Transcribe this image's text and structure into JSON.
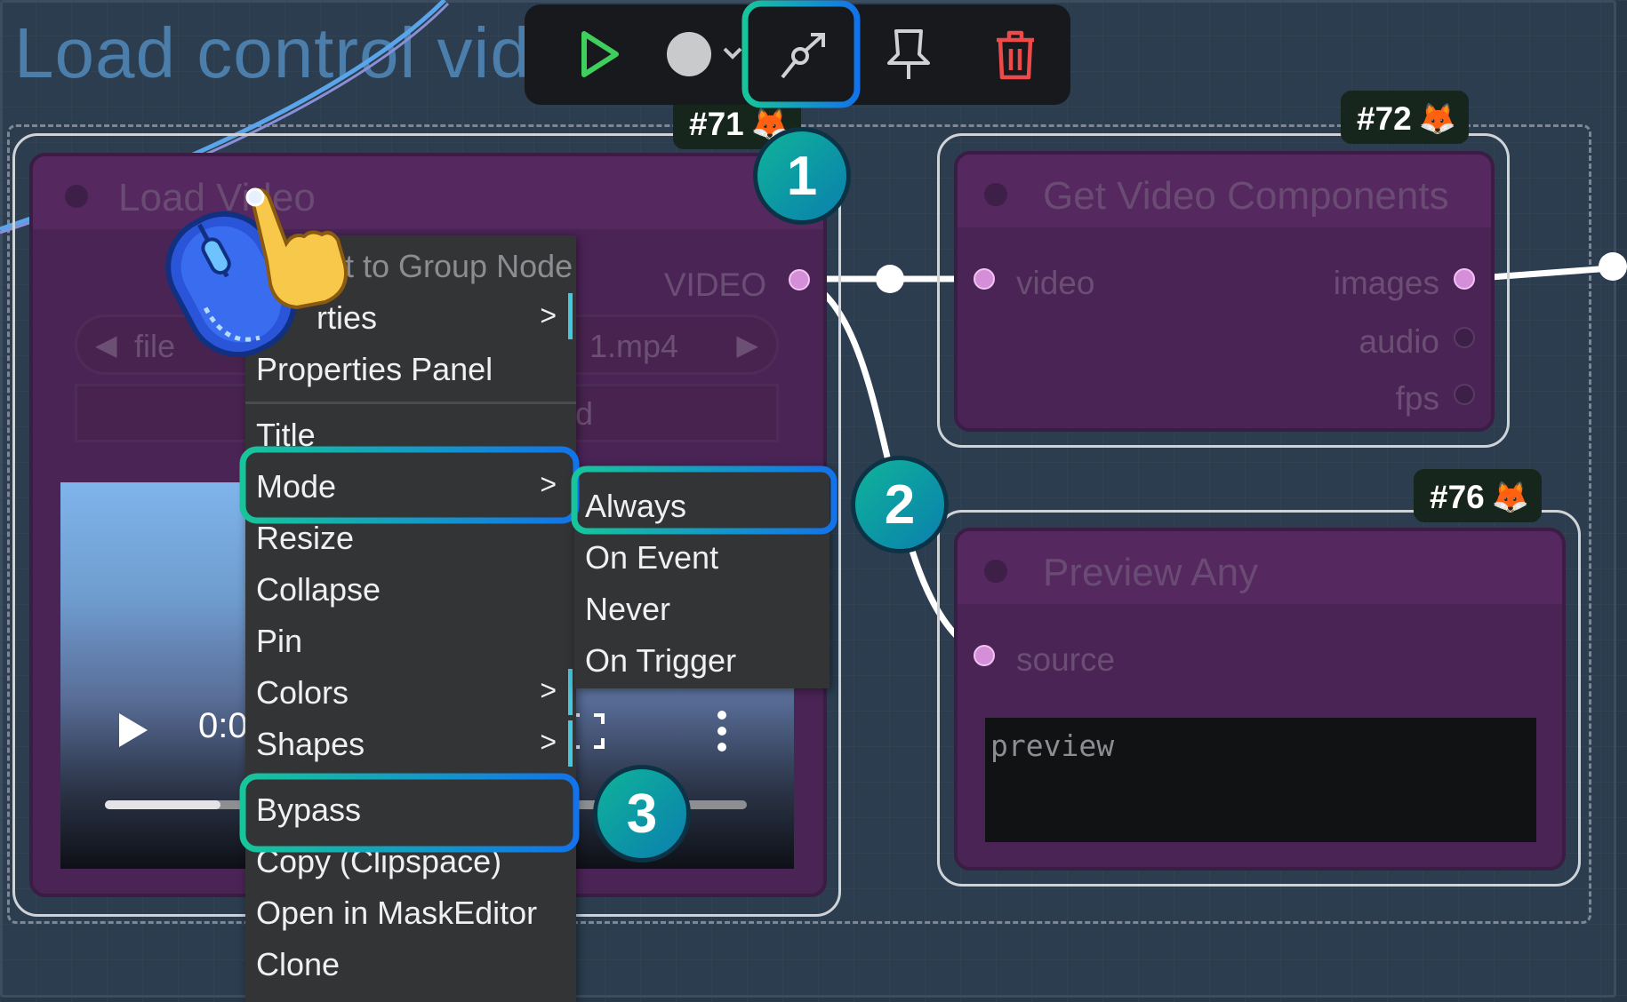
{
  "group": {
    "title": "Load control video"
  },
  "toolbar": {
    "run_icon": "play-icon",
    "color_icon": "color-circle-icon",
    "bypass_icon": "bypass-arrow-icon",
    "pin_icon": "pin-icon",
    "delete_icon": "trash-icon"
  },
  "nodes": {
    "load_video": {
      "badge": "#71",
      "title": "Load Video",
      "output_label": "VIDEO",
      "file_widget_label": "file",
      "file_widget_value": "1.mp4",
      "upload_widget_value": "d",
      "video": {
        "time": "0:0"
      }
    },
    "get_video_components": {
      "badge": "#72",
      "title": "Get Video Components",
      "inputs": [
        "video"
      ],
      "outputs": [
        "images",
        "audio",
        "fps"
      ]
    },
    "preview_any": {
      "badge": "#76",
      "title": "Preview Any",
      "input": "source",
      "preview_placeholder": "preview"
    }
  },
  "context_menu": {
    "items": [
      {
        "label": "Convert to Group Node",
        "display": "rt to Group Node",
        "disabled": true,
        "has_submenu": false
      },
      {
        "label": "Properties",
        "display": "rties",
        "disabled": false,
        "has_submenu": true
      },
      {
        "label": "Properties Panel",
        "disabled": false,
        "has_submenu": false
      },
      {
        "label": "Title",
        "disabled": false,
        "has_submenu": false
      },
      {
        "label": "Mode",
        "disabled": false,
        "has_submenu": true
      },
      {
        "label": "Resize",
        "disabled": false,
        "has_submenu": false
      },
      {
        "label": "Collapse",
        "disabled": false,
        "has_submenu": false
      },
      {
        "label": "Pin",
        "disabled": false,
        "has_submenu": false
      },
      {
        "label": "Colors",
        "disabled": false,
        "has_submenu": true
      },
      {
        "label": "Shapes",
        "disabled": false,
        "has_submenu": true
      },
      {
        "label": "Bypass",
        "disabled": false,
        "has_submenu": false
      },
      {
        "label": "Copy (Clipspace)",
        "disabled": false,
        "has_submenu": false
      },
      {
        "label": "Open in MaskEditor",
        "disabled": false,
        "has_submenu": false
      },
      {
        "label": "Clone",
        "disabled": false,
        "has_submenu": false
      }
    ],
    "arrow": ">"
  },
  "mode_submenu": {
    "items": [
      "Always",
      "On Event",
      "Never",
      "On Trigger"
    ]
  },
  "steps": [
    "1",
    "2",
    "3"
  ],
  "colors": {
    "accent_green": "#16c29a",
    "accent_blue": "#1276e8",
    "node_body": "#4b2456",
    "menu_bg": "#333436",
    "canvas_bg": "#283848"
  }
}
